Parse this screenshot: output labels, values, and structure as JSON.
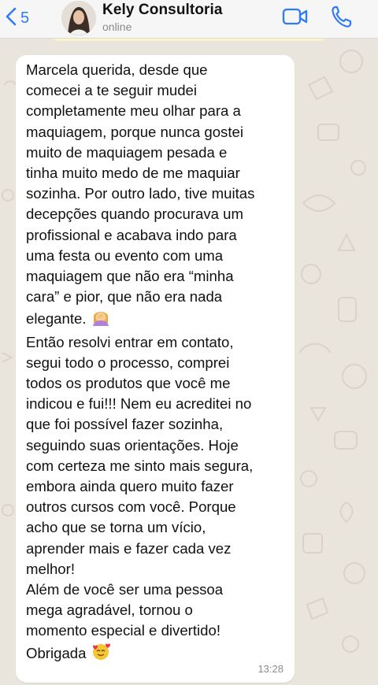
{
  "header": {
    "back_count": "5",
    "contact_name": "Kely Consultoria",
    "status": "online"
  },
  "message": {
    "paragraphs": [
      "Marcela querida,  desde que\ncomecei a te seguir mudei\ncompletamente meu olhar para a\nmaquiagem, porque nunca gostei\nmuito de maquiagem pesada e\ntinha muito medo de me maquiar\nsozinha. Por outro lado, tive muitas\ndecepções quando procurava um\nprofissional e acabava indo para\numa festa ou evento com uma\nmaquiagem que não era “minha\ncara” e pior, que não era nada\nelegante.",
      "Então resolvi entrar em contato,\nsegui todo o processo, comprei\ntodos os produtos que você me\nindicou e fui!!! Nem eu acreditei no\nque foi possível fazer sozinha,\nseguindo suas orientações. Hoje\ncom certeza me sinto mais segura,\nembora ainda quero muito fazer\noutros cursos com você. Porque\nacho que se torna um vício,\naprender mais e fazer cada vez\nmelhor!\nAlém de você ser uma pessoa\nmega agradável, tornou o\nmomento especial e divertido!\nObrigada"
    ],
    "time": "13:28"
  },
  "icons": [
    "back-chevron-icon",
    "video-call-icon",
    "phone-icon",
    "facepalm-emoji",
    "smiling-hearts-emoji"
  ],
  "colors": {
    "accent": "#2f7bf5",
    "chat_background": "#e9e4dc",
    "bubble": "#ffffff",
    "pinned": "#fbf4c8"
  }
}
